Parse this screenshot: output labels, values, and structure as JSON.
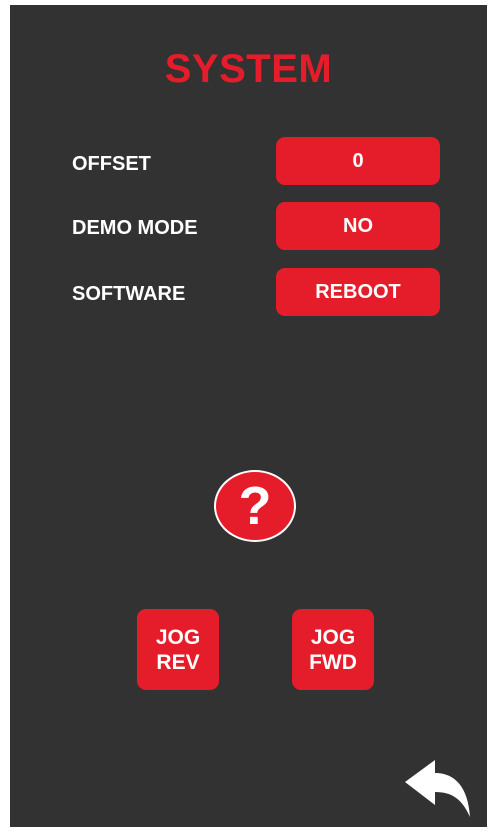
{
  "screen": {
    "title": "SYSTEM"
  },
  "settings": [
    {
      "label": "OFFSET",
      "value": "0"
    },
    {
      "label": "DEMO MODE",
      "value": "NO"
    },
    {
      "label": "SOFTWARE",
      "value": "REBOOT"
    }
  ],
  "help": {
    "glyph": "?",
    "icon": "question-mark-icon"
  },
  "jog": {
    "rev": {
      "line1": "JOG",
      "line2": "REV"
    },
    "fwd": {
      "line1": "JOG",
      "line2": "FWD"
    }
  },
  "back": {
    "icon": "back-arrow-icon"
  },
  "colors": {
    "background": "#323232",
    "accent": "#e51d2a",
    "text": "#ffffff"
  }
}
